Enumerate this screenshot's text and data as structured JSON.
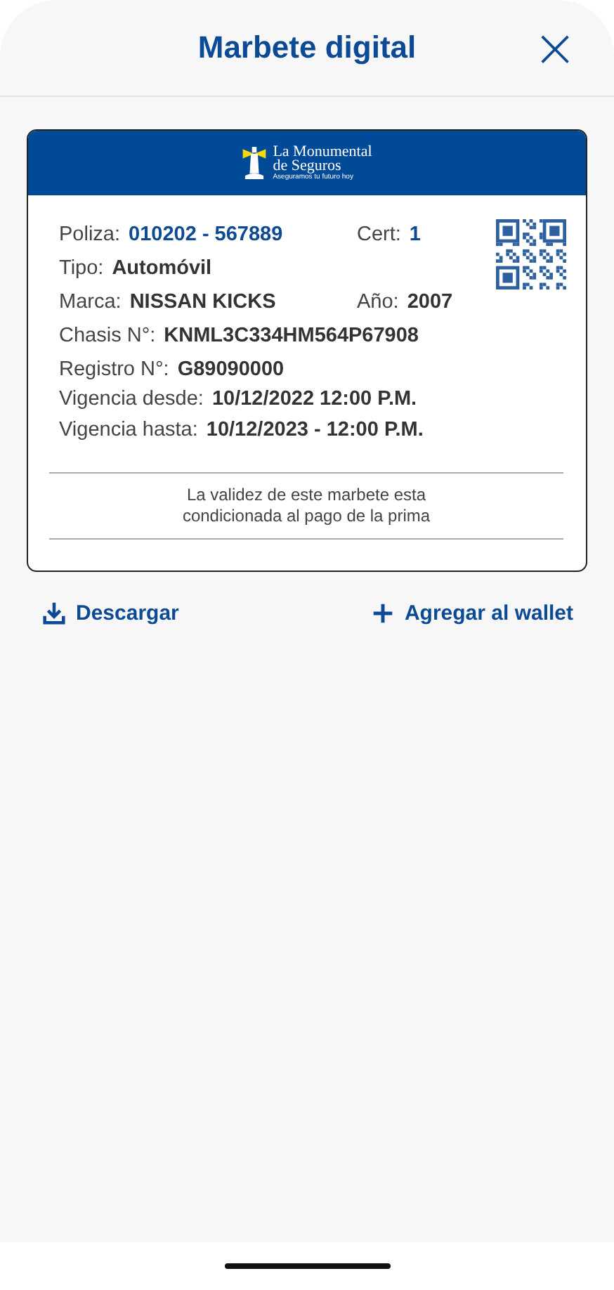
{
  "header": {
    "title": "Marbete digital",
    "close": "×"
  },
  "card": {
    "logo": {
      "name_line1": "La Monumental",
      "name_line2": "de Seguros",
      "slogan": "Aseguramos tu futuro hoy"
    },
    "rows": [
      {
        "fields": [
          {
            "label": "Poliza:",
            "value": "010202 - 567889",
            "kind": "accent"
          },
          {
            "label": "Cert:",
            "value": "1",
            "kind": "accent"
          }
        ]
      },
      {
        "fields": [
          {
            "label": "Tipo:",
            "value": "Automóvil",
            "kind": "plain"
          }
        ]
      },
      {
        "fields": [
          {
            "label": "Marca:",
            "value": "NISSAN KICKS",
            "kind": "plain"
          },
          {
            "label": "Año:",
            "value": "2007",
            "kind": "plain"
          }
        ]
      },
      {
        "fields": [
          {
            "label": "Chasis N°:",
            "value": "KNML3C334HM564P67908",
            "kind": "plain"
          }
        ]
      },
      {
        "fields": [
          {
            "label": "Registro N°:",
            "value": "G89090000",
            "kind": "plain"
          }
        ]
      },
      {
        "fields": [
          {
            "label": "Vigencia desde:",
            "value": "10/12/2022  12:00 P.M.",
            "kind": "plain"
          }
        ]
      },
      {
        "fields": [
          {
            "label": "Vigencia hasta:",
            "value": "10/12/2023 - 12:00 P.M.",
            "kind": "plain"
          }
        ]
      }
    ],
    "notice": "La validez de este marbete esta condicionada al pago de la prima"
  },
  "actions": [
    {
      "label": "Descargar",
      "kind": "download"
    },
    {
      "label": "Agregar al wallet",
      "kind": "add"
    }
  ]
}
